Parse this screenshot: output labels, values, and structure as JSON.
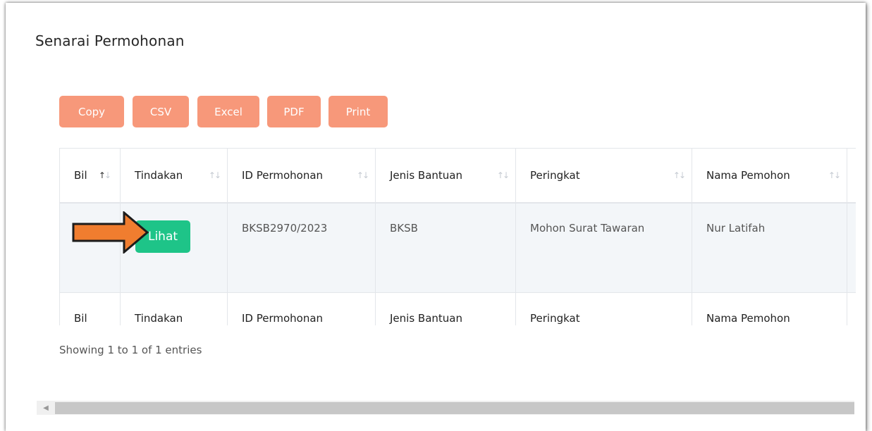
{
  "page": {
    "title": "Senarai Permohonan"
  },
  "export_buttons": [
    "Copy",
    "CSV",
    "Excel",
    "PDF",
    "Print"
  ],
  "table": {
    "columns": [
      "Bil",
      "Tindakan",
      "ID Permohonan",
      "Jenis Bantuan",
      "Peringkat",
      "Nama Pemohon"
    ],
    "rows": [
      {
        "bil": "",
        "action_label": "Lihat",
        "id_permohonan": "BKSB2970/2023",
        "jenis_bantuan": "BKSB",
        "peringkat": "Mohon Surat Tawaran",
        "nama_pemohon": "Nur Latifah"
      }
    ],
    "footer_columns": [
      "Bil",
      "Tindakan",
      "ID Permohonan",
      "Jenis Bantuan",
      "Peringkat",
      "Nama Pemohon"
    ],
    "sort_glyph": "↑↓"
  },
  "info": "Showing 1 to 1 of 1 entries",
  "scrollbar": {
    "left_arrow": "◀"
  },
  "colors": {
    "export_button": "#f7987a",
    "action_button": "#1ec488",
    "annotation_arrow": "#f07d2f"
  }
}
